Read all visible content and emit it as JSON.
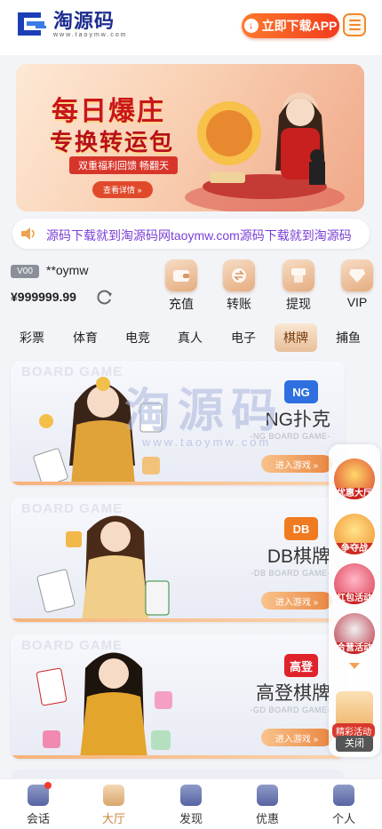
{
  "header": {
    "logo_title": "淘源码",
    "logo_sub": "www.taoymw.com",
    "download_label": "立即下载APP",
    "menu_icon": "hamburger-icon"
  },
  "banner": {
    "line1": "每日爆庄",
    "line2": "专换转运包",
    "line3": "双重福利回馈 畅翻天",
    "button": "查看详情 »"
  },
  "marquee": {
    "text": "源码下载就到淘源码网taoymw.com源码下载就到淘源码"
  },
  "wallet": {
    "vip_level": "V00",
    "username": "**oymw",
    "balance": "¥999999.99"
  },
  "actions": [
    {
      "label": "充值",
      "icon": "wallet-icon"
    },
    {
      "label": "转账",
      "icon": "transfer-icon"
    },
    {
      "label": "提现",
      "icon": "withdraw-icon"
    },
    {
      "label": "VIP",
      "icon": "diamond-icon"
    }
  ],
  "tabs": [
    "彩票",
    "体育",
    "电竞",
    "真人",
    "电子",
    "棋牌",
    "捕鱼"
  ],
  "active_tab": "棋牌",
  "games": [
    {
      "bg_word": "BOARD GAME",
      "badge": "NG",
      "name": "NG扑克",
      "sub": "-NG BOARD GAME-",
      "enter": "进入游戏 »",
      "badge_color": "#2f6fe0"
    },
    {
      "bg_word": "BOARD GAME",
      "badge": "DB",
      "name": "DB棋牌",
      "sub": "-DB BOARD GAME-",
      "enter": "进入游戏 »",
      "badge_color": "#f07a1f"
    },
    {
      "bg_word": "BOARD GAME",
      "badge": "高登",
      "name": "高登棋牌",
      "sub": "-GD BOARD GAME-",
      "enter": "进入游戏 »",
      "badge_color": "#e0222a"
    }
  ],
  "watermark": {
    "main": "淘源码",
    "url": "www.taoymw.com"
  },
  "float_panel": {
    "promos": [
      "优惠大厅",
      "争夺战",
      "红包活动",
      "合营活动"
    ],
    "gift_label": "精彩活动",
    "close": "关闭"
  },
  "tabbar": [
    {
      "label": "会话",
      "icon": "chat-icon"
    },
    {
      "label": "大厅",
      "icon": "lobby-icon"
    },
    {
      "label": "发现",
      "icon": "discover-icon"
    },
    {
      "label": "优惠",
      "icon": "promo-icon"
    },
    {
      "label": "个人",
      "icon": "profile-icon"
    }
  ],
  "colors": {
    "accent": "#f2441d",
    "gold": "#e9bf9a",
    "brand_blue": "#1c2d8f"
  }
}
